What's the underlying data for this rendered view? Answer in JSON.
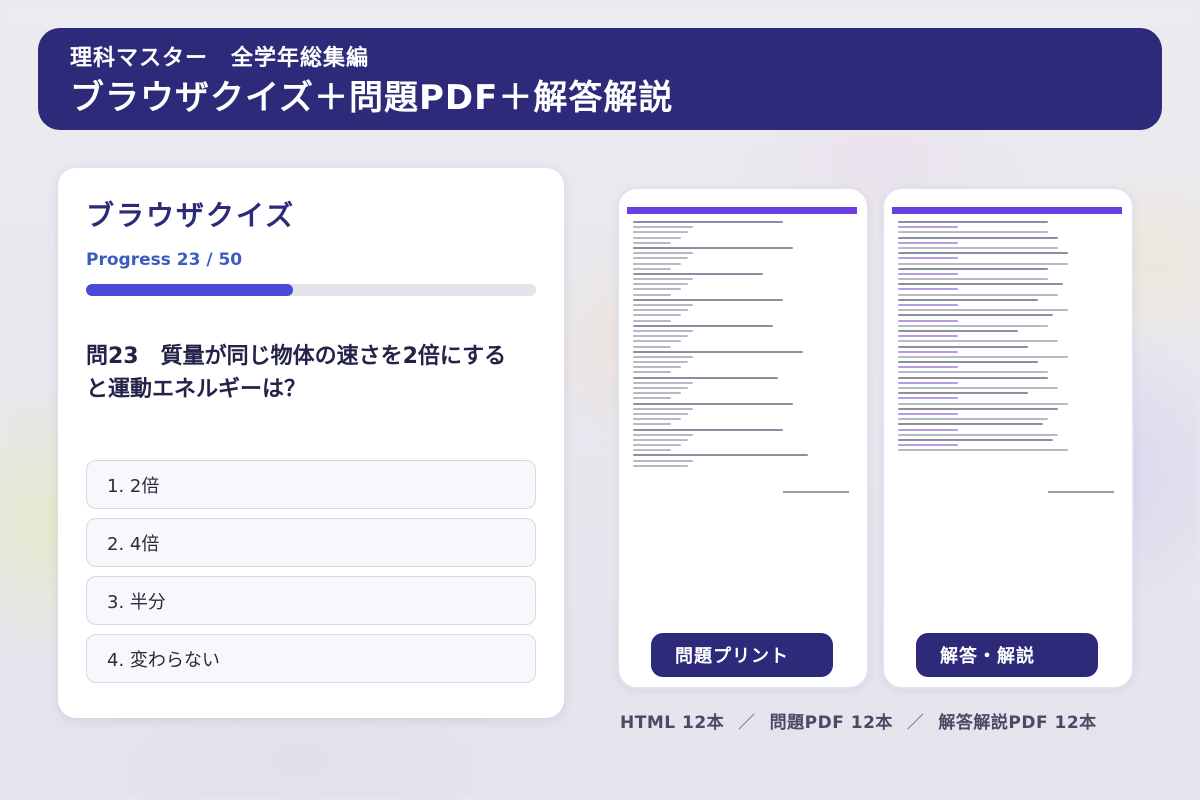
{
  "banner": {
    "subtitle": "理科マスター　全学年総集編",
    "title": "ブラウザクイズ＋問題PDF＋解答解説"
  },
  "quiz": {
    "heading": "ブラウザクイズ",
    "progress_label": "Progress  23 / 50",
    "progress_current": 23,
    "progress_total": 50,
    "question": "問23　質量が同じ物体の速さを2倍にすると運動エネルギーは？",
    "options": [
      "1. 2倍",
      "2. 4倍",
      "3. 半分",
      "4. 変わらない"
    ]
  },
  "docs": {
    "problems_button": "問題プリント",
    "answers_button": "解答・解説"
  },
  "footer": {
    "html": "HTML 12本",
    "sep1": "／",
    "problem_pdf": "問題PDF 12本",
    "sep2": "／",
    "answer_pdf": "解答解説PDF 12本"
  },
  "colors": {
    "brand": "#2d2a7a",
    "progress": "#4a48d8",
    "accent_bar": "#6a3ee0"
  }
}
